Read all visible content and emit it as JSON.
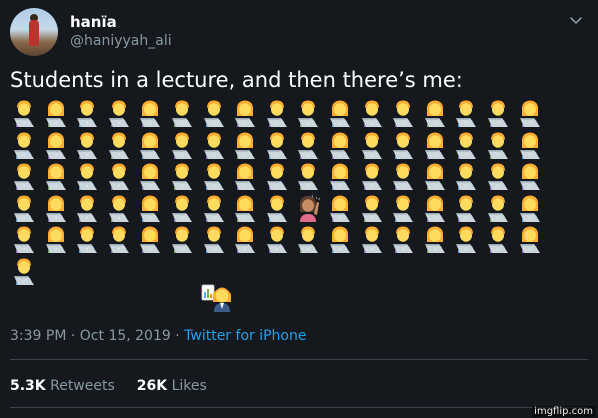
{
  "user": {
    "display_name": "hanïa",
    "handle": "@haniyyah_ali",
    "avatar_icon": "profile-photo"
  },
  "menu_icon": "chevron-down-icon",
  "tweet": {
    "text": "Students in a lecture, and then there’s me:",
    "emoji_rows": [
      17,
      17,
      17,
      17,
      17,
      1
    ],
    "student_emoji": "person-with-laptop",
    "distracted_emoji": {
      "row": 3,
      "col": 9,
      "name": "person-raising-hand"
    },
    "me_emoji": "person-teacher"
  },
  "meta": {
    "time": "3:39 PM",
    "separator1": "·",
    "date": "Oct 15, 2019",
    "separator2": "·",
    "source": "Twitter for iPhone"
  },
  "stats": {
    "retweets_count": "5.3K",
    "retweets_label": "Retweets",
    "likes_count": "26K",
    "likes_label": "Likes"
  },
  "watermark": "imgflip.com",
  "colors": {
    "background": "#15181c",
    "text": "#ffffff",
    "muted": "#8899a6",
    "link": "#1da1f2",
    "divider": "#38444d"
  }
}
